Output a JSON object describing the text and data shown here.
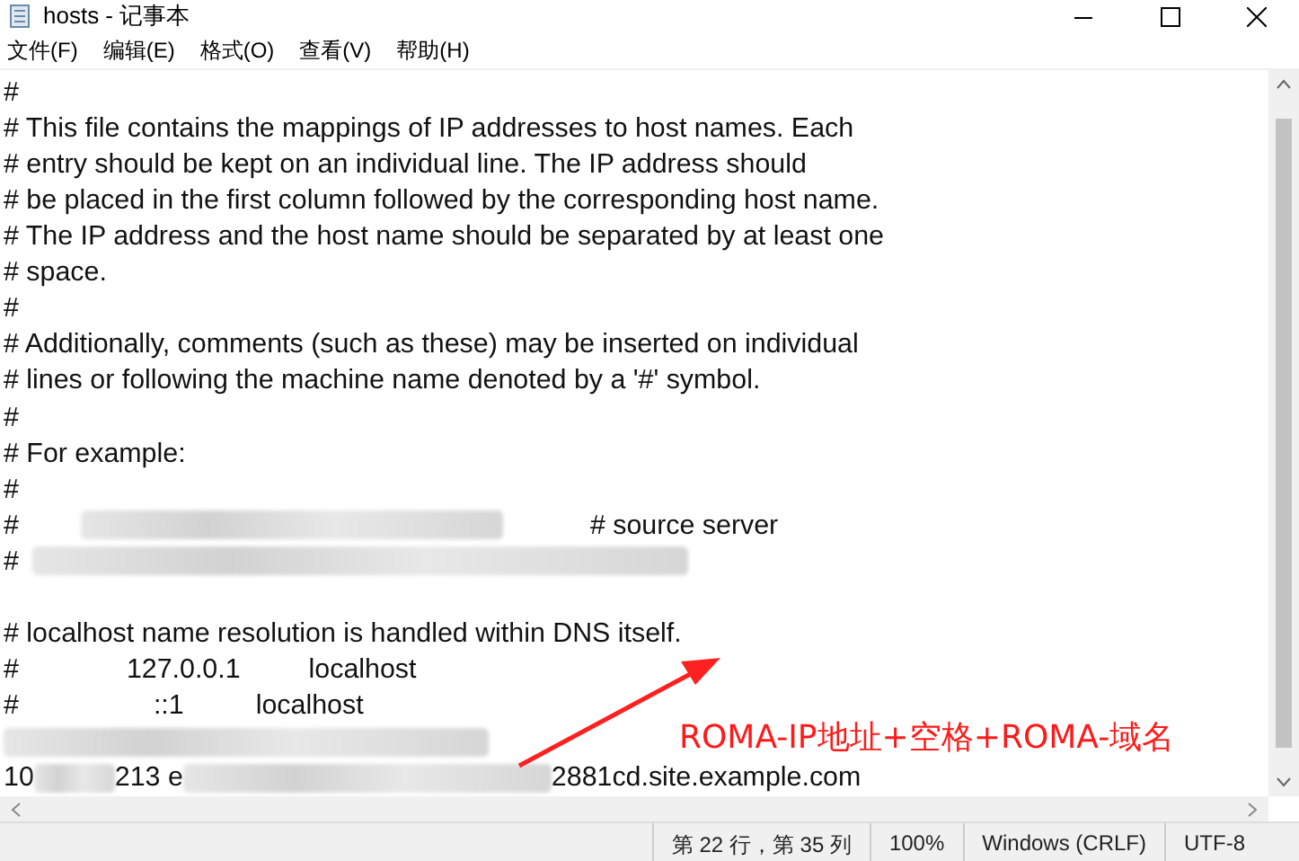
{
  "window": {
    "title": "hosts - 记事本"
  },
  "menu": [
    {
      "label": "文件(F)"
    },
    {
      "label": "编辑(E)"
    },
    {
      "label": "格式(O)"
    },
    {
      "label": "查看(V)"
    },
    {
      "label": "帮助(H)"
    }
  ],
  "editor": {
    "lines": [
      [
        {
          "kind": "text",
          "text": "#"
        }
      ],
      [
        {
          "kind": "text",
          "text": "# This file contains the mappings of IP addresses to host names. Each"
        }
      ],
      [
        {
          "kind": "text",
          "text": "# entry should be kept on an individual line. The IP address should"
        }
      ],
      [
        {
          "kind": "text",
          "text": "# be placed in the first column followed by the corresponding host name."
        }
      ],
      [
        {
          "kind": "text",
          "text": "# The IP address and the host name should be separated by at least one"
        }
      ],
      [
        {
          "kind": "text",
          "text": "# space."
        }
      ],
      [
        {
          "kind": "text",
          "text": "#"
        }
      ],
      [
        {
          "kind": "text",
          "text": "# Additionally, comments (such as these) may be inserted on individual"
        }
      ],
      [
        {
          "kind": "text",
          "text": "# lines or following the machine name denoted by a '#' symbol."
        }
      ],
      [
        {
          "kind": "text",
          "text": "#"
        }
      ],
      [
        {
          "kind": "text",
          "text": "# For example:"
        }
      ],
      [
        {
          "kind": "text",
          "text": "#"
        }
      ],
      [
        {
          "kind": "text",
          "text": "#"
        },
        {
          "kind": "blur"
        },
        {
          "kind": "text",
          "text": "# source server"
        }
      ],
      [
        {
          "kind": "text",
          "text": "#"
        },
        {
          "kind": "blur"
        }
      ],
      {
        "kind": "blank"
      },
      [
        {
          "kind": "text",
          "text": "# localhost name resolution is handled within DNS itself."
        }
      ],
      [
        {
          "kind": "text",
          "text": "#"
        },
        {
          "kind": "gap"
        },
        {
          "kind": "text",
          "text": "127.0.0.1"
        },
        {
          "kind": "gap"
        },
        {
          "kind": "text",
          "text": "localhost"
        }
      ],
      [
        {
          "kind": "text",
          "text": "#"
        },
        {
          "kind": "gap"
        },
        {
          "kind": "text",
          "text": "::1"
        },
        {
          "kind": "gap"
        },
        {
          "kind": "text",
          "text": "localhost"
        }
      ],
      [
        {
          "kind": "blur"
        }
      ],
      [
        {
          "kind": "text",
          "text": "10"
        },
        {
          "kind": "blur"
        },
        {
          "kind": "text",
          "text": "213 e"
        },
        {
          "kind": "blur"
        },
        {
          "kind": "text",
          "text": "2881cd.site.example.com"
        }
      ]
    ]
  },
  "annotation": {
    "text": "ROMA-IP地址+空格+ROMA-域名"
  },
  "status_bar": [
    {
      "text": "第 22 行，第 35 列"
    },
    {
      "text": "100%"
    },
    {
      "text": "Windows (CRLF)"
    },
    {
      "text": "UTF-8"
    }
  ]
}
